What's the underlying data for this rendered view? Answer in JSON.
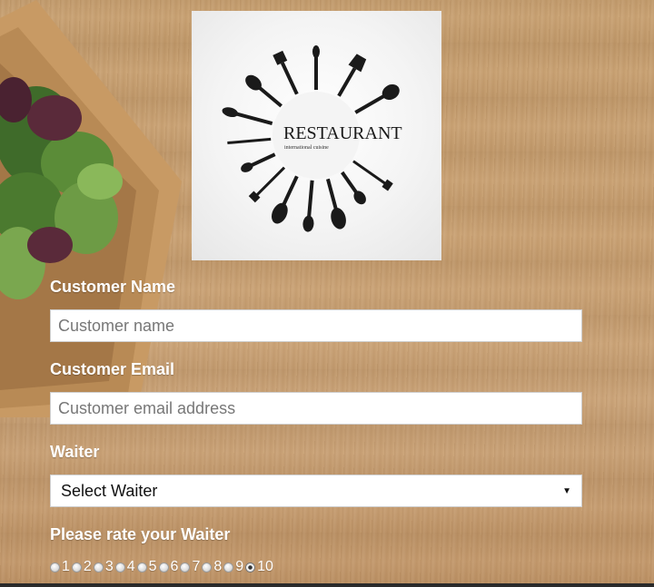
{
  "logo": {
    "brand": "RESTAURANT",
    "tagline": "international cuisine"
  },
  "form": {
    "customer_name_label": "Customer Name",
    "customer_name_placeholder": "Customer name",
    "customer_email_label": "Customer Email",
    "customer_email_placeholder": "Customer email address",
    "waiter_label": "Waiter",
    "waiter_selected": "Select Waiter",
    "rating_label": "Please rate your Waiter",
    "rating_options": [
      "1",
      "2",
      "3",
      "4",
      "5",
      "6",
      "7",
      "8",
      "9",
      "10"
    ],
    "rating_selected": "10"
  },
  "colors": {
    "label": "#ffffff",
    "background_wood": "#c9a071"
  }
}
